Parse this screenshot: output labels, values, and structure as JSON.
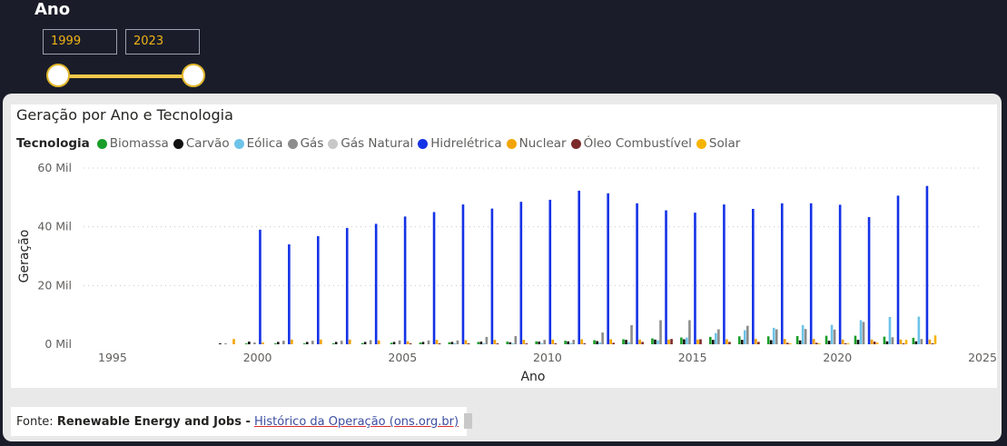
{
  "slicer": {
    "title": "Ano",
    "start_year": "1999",
    "end_year": "2023",
    "range": [
      1999,
      2023
    ]
  },
  "source": {
    "prefix": "Fonte: ",
    "org": "Renewable Energy and Jobs -",
    "link": "Histórico da Operação (ons.org.br)"
  },
  "chart_data": {
    "type": "bar",
    "title": "Geração por Ano e Tecnologia",
    "legend_title": "Tecnologia",
    "xlabel": "Ano",
    "ylabel": "Geração",
    "xlim": [
      1994,
      2025
    ],
    "ylim": [
      0,
      60000
    ],
    "x_ticks": [
      {
        "value": 1995,
        "label": "1995"
      },
      {
        "value": 2000,
        "label": "2000"
      },
      {
        "value": 2005,
        "label": "2005"
      },
      {
        "value": 2010,
        "label": "2010"
      },
      {
        "value": 2015,
        "label": "2015"
      },
      {
        "value": 2020,
        "label": "2020"
      },
      {
        "value": 2025,
        "label": "2025"
      }
    ],
    "y_ticks": [
      {
        "value": 0,
        "label": "0 Mil"
      },
      {
        "value": 20000,
        "label": "20 Mil"
      },
      {
        "value": 40000,
        "label": "40 Mil"
      },
      {
        "value": 60000,
        "label": "60 Mil"
      }
    ],
    "grid": "horizontal dotted",
    "legend_position": "top-left",
    "categories": [
      1999,
      2000,
      2001,
      2002,
      2003,
      2004,
      2005,
      2006,
      2007,
      2008,
      2009,
      2010,
      2011,
      2012,
      2013,
      2014,
      2015,
      2016,
      2017,
      2018,
      2019,
      2020,
      2021,
      2022,
      2023
    ],
    "series": [
      {
        "name": "Biomassa",
        "color": "#1a9e2a",
        "values": [
          0,
          50,
          100,
          200,
          300,
          400,
          500,
          600,
          700,
          800,
          900,
          1000,
          1200,
          1400,
          1700,
          2000,
          2300,
          2500,
          2700,
          2700,
          2800,
          2900,
          2900,
          2600,
          2200
        ]
      },
      {
        "name": "Carvão",
        "color": "#111111",
        "values": [
          300,
          900,
          800,
          800,
          800,
          800,
          800,
          800,
          800,
          900,
          700,
          900,
          1000,
          1100,
          1500,
          1600,
          1700,
          1500,
          1500,
          1400,
          1300,
          1200,
          1500,
          1000,
          1000
        ]
      },
      {
        "name": "Eólica",
        "color": "#6ec3e8",
        "values": [
          0,
          0,
          0,
          0,
          0,
          0,
          0,
          0,
          100,
          100,
          200,
          300,
          400,
          600,
          700,
          1300,
          2300,
          3800,
          4800,
          5600,
          6500,
          6600,
          8200,
          9300,
          9400
        ]
      },
      {
        "name": "Gás",
        "color": "#8c8c8c",
        "values": [
          100,
          600,
          1200,
          1200,
          1200,
          1400,
          1300,
          1300,
          1300,
          2500,
          2800,
          1500,
          1500,
          4000,
          6500,
          8200,
          8200,
          5100,
          6300,
          5100,
          5200,
          5000,
          7600,
          2400,
          1800
        ]
      },
      {
        "name": "Gás Natural",
        "color": "#c8c8c8",
        "values": [
          0,
          0,
          0,
          0,
          0,
          0,
          0,
          0,
          0,
          0,
          0,
          0,
          0,
          0,
          0,
          0,
          0,
          0,
          0,
          0,
          0,
          0,
          0,
          0,
          0
        ]
      },
      {
        "name": "Hidrelétrica",
        "color": "#1432e6",
        "values": [
          0,
          39000,
          34000,
          36800,
          39600,
          41000,
          43500,
          45000,
          47600,
          46200,
          48500,
          49200,
          52300,
          51400,
          48000,
          45600,
          44800,
          47600,
          46100,
          48000,
          48000,
          47500,
          43300,
          50600,
          53900
        ]
      },
      {
        "name": "Nuclear",
        "color": "#f2a500",
        "values": [
          1800,
          600,
          1600,
          1600,
          1600,
          1300,
          1000,
          1500,
          1400,
          1500,
          1500,
          1600,
          1700,
          1700,
          1600,
          1600,
          1600,
          1700,
          1800,
          1800,
          1800,
          1600,
          1600,
          1600,
          1600
        ]
      },
      {
        "name": "Óleo Combustível",
        "color": "#7b2a2a",
        "values": [
          0,
          0,
          0,
          0,
          0,
          0,
          100,
          100,
          100,
          200,
          200,
          200,
          300,
          500,
          800,
          1800,
          1700,
          800,
          800,
          500,
          500,
          300,
          900,
          200,
          200
        ]
      },
      {
        "name": "Solar",
        "color": "#f7b400",
        "values": [
          0,
          0,
          0,
          0,
          0,
          0,
          0,
          0,
          0,
          0,
          0,
          0,
          0,
          0,
          0,
          0,
          0,
          0,
          0,
          100,
          200,
          300,
          600,
          1500,
          3000
        ]
      }
    ]
  }
}
